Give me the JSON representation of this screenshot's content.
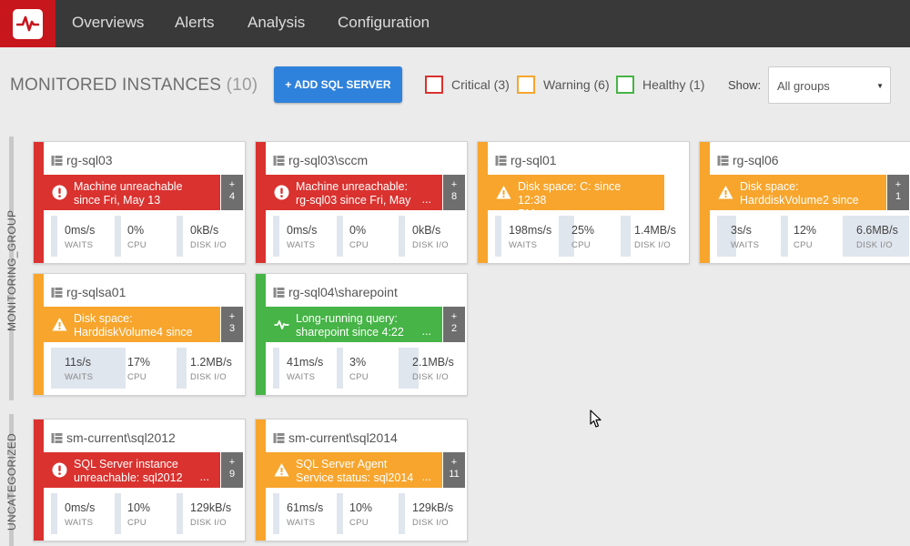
{
  "colors": {
    "critical": "#d9322f",
    "warning": "#f7a52d",
    "healthy": "#46b446",
    "nav_bg": "#393939",
    "brand": "#c8161d",
    "accent": "#2f82db"
  },
  "nav": {
    "logo_icon": "pulse-logo-icon",
    "items": [
      "Overviews",
      "Alerts",
      "Analysis",
      "Configuration"
    ]
  },
  "header": {
    "title": "MONITORED INSTANCES",
    "count": "(10)",
    "add_button": "+ ADD SQL SERVER",
    "legend": [
      {
        "label": "Critical (3)",
        "color": "#d9322f"
      },
      {
        "label": "Warning (6)",
        "color": "#f7a52d"
      },
      {
        "label": "Healthy (1)",
        "color": "#46b446"
      }
    ],
    "show_label": "Show:",
    "group_select": "All groups"
  },
  "groups": [
    {
      "label": "MONITORING_GROUP"
    },
    {
      "label": "UNCATEGORIZED"
    }
  ],
  "cards": [
    {
      "name": "rg-sql03",
      "status": "critical",
      "alert_line1": "Machine unreachable",
      "alert_line2": "since Fri, May 13",
      "ellipsis": "",
      "plus": "+",
      "plus_count": "4",
      "waits": "0ms/s",
      "cpu": "0%",
      "disk": "0kB/s",
      "waits_level": 0,
      "cpu_level": 0,
      "disk_level": 0
    },
    {
      "name": "rg-sql03\\sccm",
      "status": "critical",
      "alert_line1": "Machine unreachable:",
      "alert_line2": "rg-sql03 since Fri, May",
      "ellipsis": "...",
      "plus": "+",
      "plus_count": "8",
      "waits": "0ms/s",
      "cpu": "0%",
      "disk": "0kB/s",
      "waits_level": 0,
      "cpu_level": 0,
      "disk_level": 0
    },
    {
      "name": "rg-sql01",
      "status": "warning",
      "alert_line1": "Disk space: C: since 12:38",
      "alert_line2": "PM",
      "ellipsis": "",
      "plus": "",
      "plus_count": "",
      "waits": "198ms/s",
      "cpu": "25%",
      "disk": "1.4MB/s",
      "waits_level": 0.1,
      "cpu_level": 0.25,
      "disk_level": 0.15
    },
    {
      "name": "rg-sql06",
      "status": "warning",
      "alert_line1": "Disk space:",
      "alert_line2": "HarddiskVolume2 since ...",
      "ellipsis": "",
      "plus": "+",
      "plus_count": "1",
      "waits": "3s/s",
      "cpu": "12%",
      "disk": "6.6MB/s",
      "waits_level": 0.3,
      "cpu_level": 0.12,
      "disk_level": 1
    },
    {
      "name": "rg-sqlsa01",
      "status": "warning",
      "alert_line1": "Disk space:",
      "alert_line2": "HarddiskVolume4 since ...",
      "ellipsis": "",
      "plus": "+",
      "plus_count": "3",
      "waits": "11s/s",
      "cpu": "17%",
      "disk": "1.2MB/s",
      "waits_level": 1,
      "cpu_level": 0.17,
      "disk_level": 0.15
    },
    {
      "name": "rg-sql04\\sharepoint",
      "status": "healthy",
      "alert_line1": "Long-running query:",
      "alert_line2": "sharepoint since 4:22",
      "ellipsis": "...",
      "plus": "+",
      "plus_count": "2",
      "waits": "41ms/s",
      "cpu": "3%",
      "disk": "2.1MB/s",
      "waits_level": 0,
      "cpu_level": 0.03,
      "disk_level": 0.3
    },
    {
      "name": "sm-current\\sql2012",
      "status": "critical",
      "alert_line1": "SQL Server instance",
      "alert_line2": "unreachable: sql2012",
      "ellipsis": "...",
      "plus": "+",
      "plus_count": "9",
      "waits": "0ms/s",
      "cpu": "10%",
      "disk": "129kB/s",
      "waits_level": 0,
      "cpu_level": 0.1,
      "disk_level": 0.02
    },
    {
      "name": "sm-current\\sql2014",
      "status": "warning",
      "alert_line1": "SQL Server Agent",
      "alert_line2": "Service status: sql2014",
      "ellipsis": "...",
      "plus": "+",
      "plus_count": "11",
      "waits": "61ms/s",
      "cpu": "10%",
      "disk": "129kB/s",
      "waits_level": 0,
      "cpu_level": 0.1,
      "disk_level": 0.02
    }
  ],
  "metric_labels": {
    "waits": "WAITS",
    "cpu": "CPU",
    "disk": "DISK I/O"
  },
  "banner_icons": {
    "critical": "exclamation-circle-icon",
    "warning": "warning-triangle-icon",
    "healthy": "pulse-icon"
  }
}
